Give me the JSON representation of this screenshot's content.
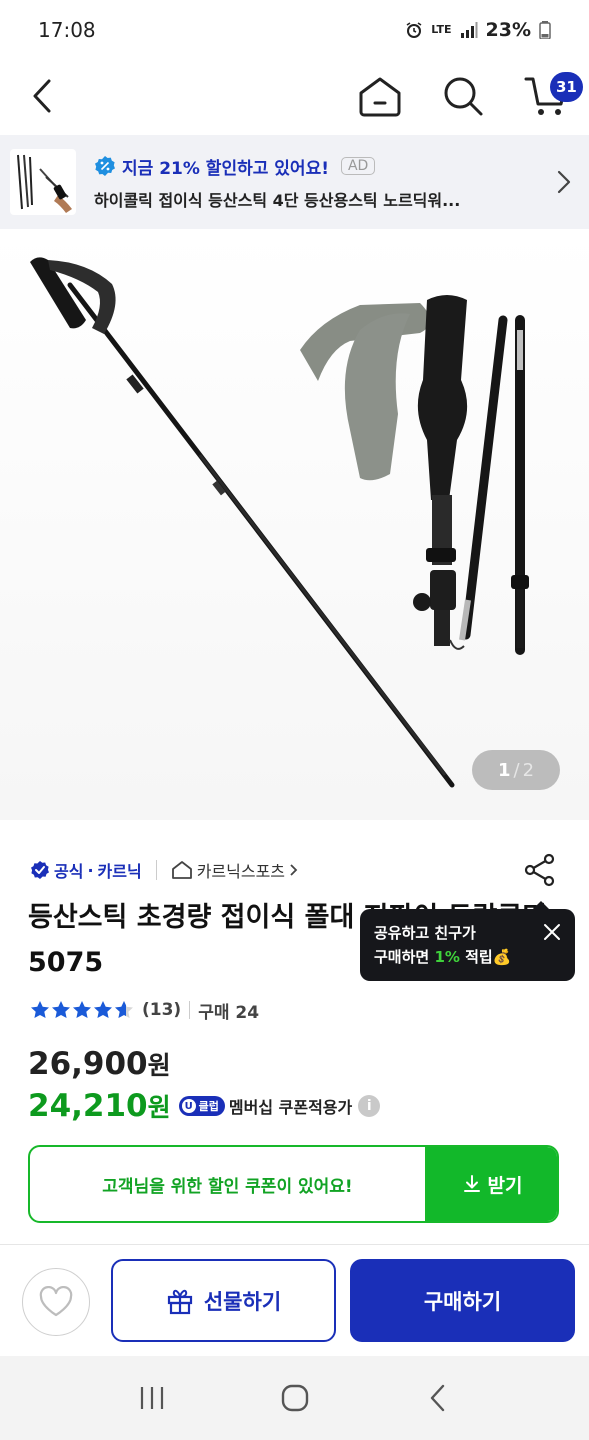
{
  "status_bar": {
    "time": "17:08",
    "network": "LTE",
    "battery": "23%"
  },
  "nav": {
    "cart_count": "31"
  },
  "ad": {
    "headline": "지금 21% 할인하고 있어요!",
    "tag": "AD",
    "product_name": "하이콜릭 접이식 등산스틱 4단 등산용스틱 노르딕워..."
  },
  "image": {
    "current": "1",
    "separator": "/",
    "total": "2"
  },
  "brand": {
    "official_label": "공식",
    "brand_name": "카르닉",
    "store_name": "카르닉스포츠"
  },
  "product": {
    "title": "등산스틱 초경량 접이식 폴대 지팡이 두랄루민 5075"
  },
  "share_tooltip": {
    "line1": "공유하고 친구가",
    "line2_prefix": "구매하면 ",
    "line2_highlight": "1%",
    "line2_suffix": " 적립💰"
  },
  "rating": {
    "score": 4.6,
    "review_count": "(13)",
    "purchase": "구매 24"
  },
  "price": {
    "original": "26,900",
    "original_unit": "원",
    "member": "24,210",
    "member_unit": "원",
    "badge": "클럽",
    "member_label": "멤버십 쿠폰적용가",
    "info": "i"
  },
  "coupon": {
    "message": "고객님을 위한 할인 쿠폰이 있어요!",
    "button": "받기"
  },
  "bottom": {
    "gift_label": "선물하기",
    "buy_label": "구매하기"
  },
  "colors": {
    "brand_blue": "#1a2fb8",
    "member_green": "#0d9a1e",
    "coupon_green": "#17b82a",
    "tooltip_bg": "#16171b"
  }
}
